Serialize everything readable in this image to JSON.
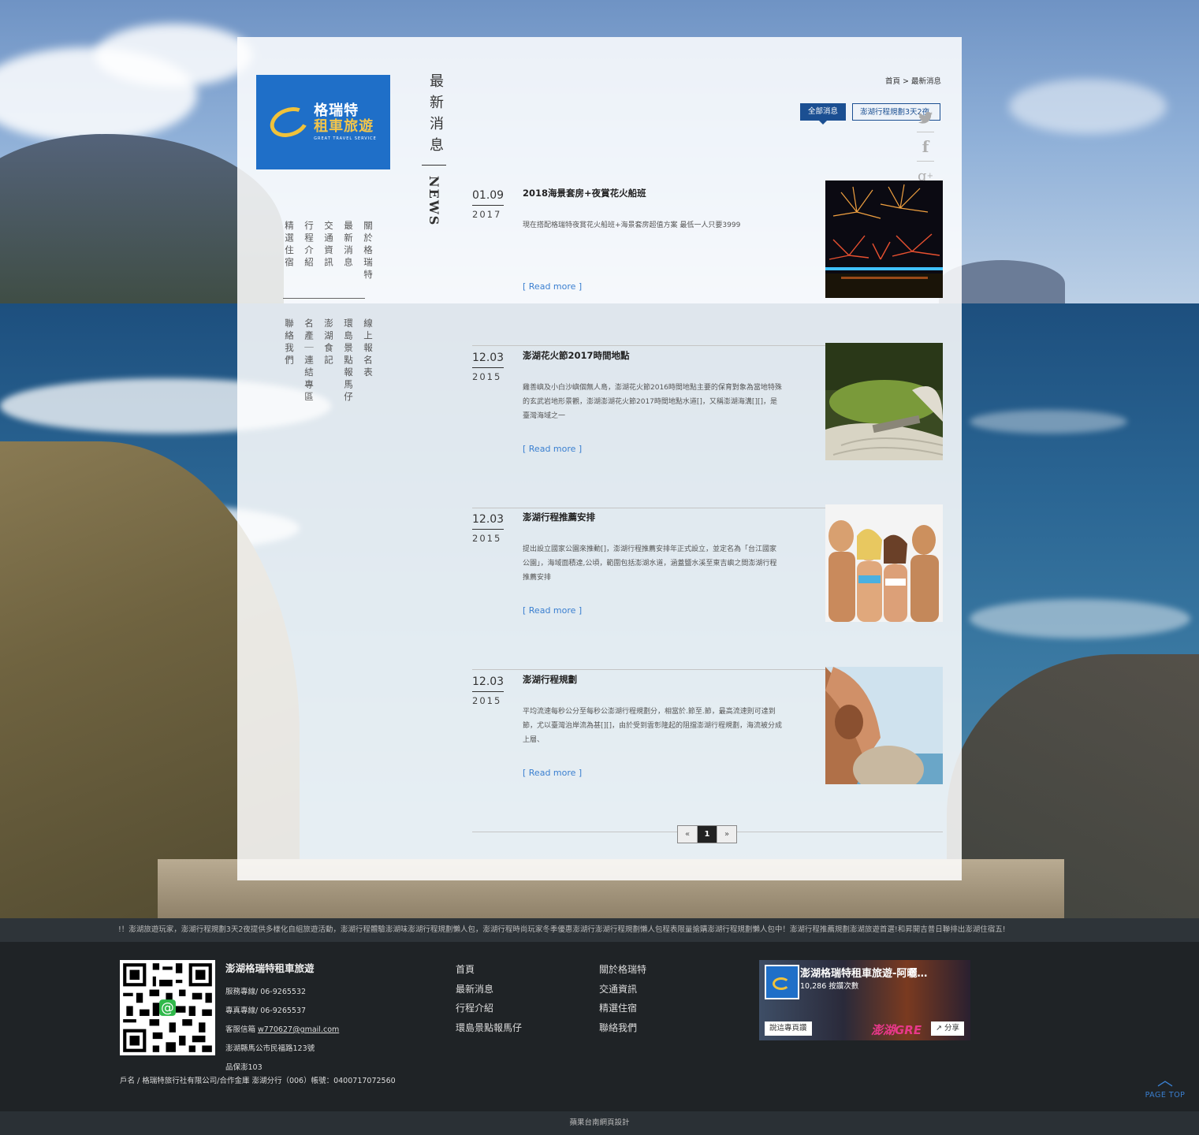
{
  "logo": {
    "line1": "格瑞特",
    "line2": "租車旅遊",
    "line3": "GREAT TRAVEL SERVICE"
  },
  "nav_top": [
    "關於格瑞特",
    "最新消息",
    "交通資訊",
    "行程介紹",
    "精選住宿"
  ],
  "nav_bottom": [
    "線上報名表",
    "環島景點報馬仔",
    "澎湖食記",
    "名產｜連結專區",
    "聯絡我們"
  ],
  "section": {
    "title": "最新消息",
    "en": "NEWS"
  },
  "breadcrumb": "首頁 > 最新消息",
  "tabs": [
    {
      "label": "全部消息",
      "active": true
    },
    {
      "label": "澎湖行程規劃3天2夜",
      "active": false
    }
  ],
  "share_icons": [
    "twitter-icon",
    "facebook-icon",
    "google-plus-icon",
    "rss-icon"
  ],
  "news": [
    {
      "md": "01.09",
      "year": "2017",
      "title": "2018海景套房+夜賞花火船班",
      "excerpt": "現在搭配格瑞特夜賞花火船班+海景套房超值方案 最低一人只要3999",
      "more": "[ Read more ]",
      "thumb": "fireworks-photo"
    },
    {
      "md": "12.03",
      "year": "2015",
      "title": "澎湖花火節2017時間地點",
      "excerpt": "雞善嶼及小白沙嶼個無人島，澎湖花火節2016時間地點主要的保育對象為當地特殊的玄武岩地形景觀，澎湖澎湖花火節2017時間地點水道[]，又稱澎湖海溝[][]，是臺灣海域之一",
      "more": "[ Read more ]",
      "thumb": "zen-garden-photo"
    },
    {
      "md": "12.03",
      "year": "2015",
      "title": "澎湖行程推薦安排",
      "excerpt": "提出設立國家公園來推動[]，澎湖行程推薦安排年正式設立，並定名為「台江國家公園」，海域面積達,公頃，範圍包括澎湖水道，涵蓋鹽水溪至東吉嶼之間澎湖行程推薦安排",
      "more": "[ Read more ]",
      "thumb": "beach-friends-photo"
    },
    {
      "md": "12.03",
      "year": "2015",
      "title": "澎湖行程規劃",
      "excerpt": "平均流速每秒公分至每秒公澎湖行程規劃分，相當於.節至.節，最高流速則可達到節，尤以臺灣治岸流為甚[][]，由於受到雲彰隆起的阻擋澎湖行程規劃，海流被分成上層、",
      "more": "[ Read more ]",
      "thumb": "beach-couple-photo"
    }
  ],
  "pager": {
    "prev": "«",
    "current": "1",
    "next": "»"
  },
  "ticker": "!！澎湖旅遊玩家，澎湖行程規劃3天2夜提供多樣化自組旅遊活動，澎湖行程體驗澎湖味澎湖行程規劃懶人包，澎湖行程時尚玩家冬季優惠澎湖行澎湖行程規劃懶人包程表限量搶購澎湖行程規劃懶人包中！澎湖行程推薦規劃澎湖旅遊首選!和昇開吉普日聯排出澎湖住宿五!",
  "company": {
    "name": "澎湖格瑞特租車旅遊",
    "service": "服務專線/ 06-9265532",
    "fax": "專真專線/ 06-9265537",
    "email_label": "客服信箱 ",
    "email": "w770627@gmail.com",
    "address": "澎湖縣馬公市民福路123號",
    "license": "品保澎103",
    "bank": "戶名 / 格瑞特旅行社有限公司/合作金庫 澎湖分行（006）帳號：0400717072560"
  },
  "footer_nav_1": [
    "首頁",
    "最新消息",
    "行程介紹",
    "環島景點報馬仔"
  ],
  "footer_nav_2": [
    "關於格瑞特",
    "交通資訊",
    "精選住宿",
    "聯絡我們"
  ],
  "facebook": {
    "title": "澎湖格瑞特租車旅遊-阿曬…",
    "count": "10,286 按讚次數",
    "like": "說這專頁讚",
    "share": "分享",
    "brand": "澎湖GRE"
  },
  "pagetop": {
    "label": "PAGE TOP"
  },
  "copyright": "蘋果台南網頁設計",
  "colors": {
    "accent_blue": "#1b4f92",
    "link_blue": "#3a7fd0",
    "logo_blue": "#1f6fc8",
    "logo_gold": "#f0c23b",
    "footer_bg": "#1f2326"
  }
}
